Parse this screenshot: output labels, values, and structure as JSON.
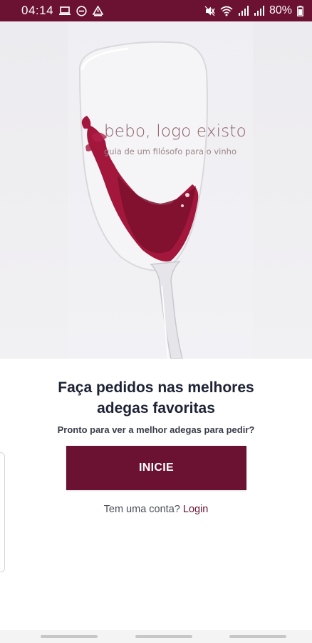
{
  "status_bar": {
    "time": "04:14",
    "battery_percent": "80%",
    "background_color": "#6b1233",
    "left_icons": [
      "laptop-icon",
      "do-not-disturb-icon",
      "alert-icon"
    ],
    "right_icons": [
      "mute-icon",
      "wifi-icon",
      "signal-icon",
      "signal-icon",
      "battery-icon"
    ]
  },
  "hero": {
    "title": "bebo, logo existo",
    "subtitle": "guia de um filósofo para o vinho"
  },
  "main": {
    "headline_line1": "Faça pedidos nas melhores",
    "headline_line2": "adegas favoritas",
    "subline": "Pronto para ver a melhor adegas para pedir?",
    "cta_label": "INICIE",
    "account_prompt": "Tem uma conta? ",
    "login_label": "Login"
  },
  "colors": {
    "brand": "#6b1233",
    "headline": "#1d2235",
    "wine": "#9b1535"
  }
}
